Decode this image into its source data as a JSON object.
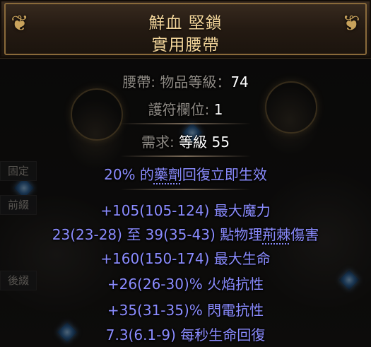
{
  "item": {
    "name_line1": "鮮血 堅鎖",
    "name_line2": "實用腰帶",
    "rarity_color": "#f3d59a"
  },
  "properties": {
    "belt_label": "腰帶: ",
    "item_level_label": "物品等級：",
    "item_level_value": "74",
    "charm_slots_label": "護符欄位: ",
    "charm_slots_value": "1",
    "requires_label": "需求: ",
    "requires_level_label": "等級 ",
    "requires_level_value": "55"
  },
  "implicit": {
    "text_prefix": "20% 的",
    "text_underlined": "藥劑",
    "text_suffix": "回復立即生效"
  },
  "mods": [
    {
      "text": "+105(105-124) 最大魔力"
    },
    {
      "text_prefix": "23(23-28) 至 39(35-43) 點物理",
      "text_underlined": "荊棘",
      "text_suffix": "傷害"
    },
    {
      "text": "+160(150-174) 最大生命"
    },
    {
      "text": "+26(26-30)% 火焰抗性"
    },
    {
      "text": "+35(31-35)% 閃電抗性"
    },
    {
      "text": "7.3(6.1-9) 每秒生命回復"
    }
  ],
  "side_tabs": {
    "fixed": "固定",
    "prefix": "前綴",
    "suffix": "後綴"
  },
  "colors": {
    "magic_mod": "#8b8cff",
    "property_label": "#8e8a84",
    "property_value": "#ffffff"
  },
  "icons": {
    "corner_left": "ornament-icon",
    "corner_right": "ornament-icon"
  }
}
